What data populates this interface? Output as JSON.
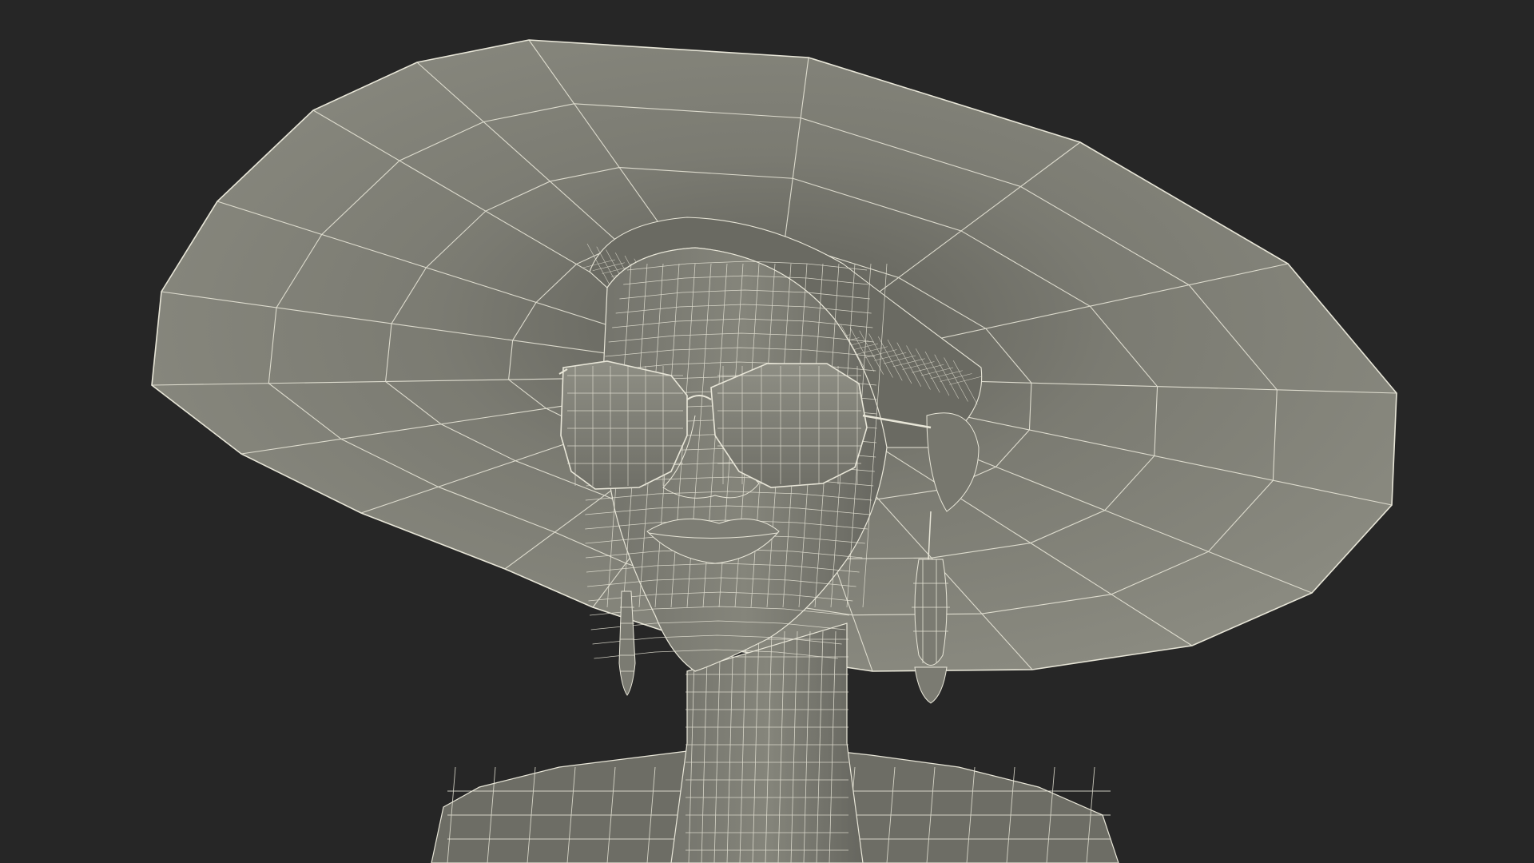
{
  "scene": {
    "subject": "wireframe-female-bust",
    "colors": {
      "background": "#262626",
      "surface": "#7b7b72",
      "surface_light": "#8c8c82",
      "surface_dark": "#55554f",
      "wire": "#e8e6d8"
    },
    "elements": [
      "sun-hat",
      "hair",
      "face",
      "sunglasses",
      "earrings",
      "neck",
      "shoulders"
    ]
  }
}
